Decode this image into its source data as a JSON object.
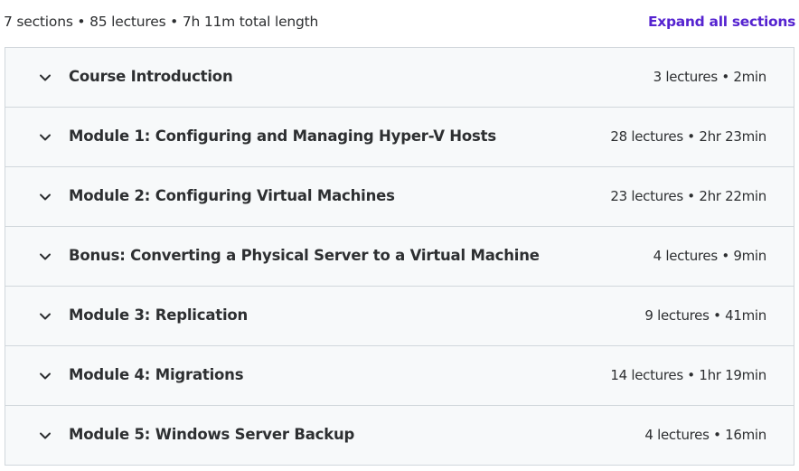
{
  "curriculum": {
    "summary": "7 sections • 85 lectures • 7h 11m total length",
    "expand_all_label": "Expand all sections",
    "accent_color": "#5624d0",
    "sections": [
      {
        "title": "Course Introduction",
        "meta": "3 lectures • 2min",
        "icon": "chevron-down-icon"
      },
      {
        "title": "Module 1: Configuring and Managing Hyper-V Hosts",
        "meta": "28 lectures • 2hr 23min",
        "icon": "chevron-down-icon"
      },
      {
        "title": "Module 2: Configuring Virtual Machines",
        "meta": "23 lectures • 2hr 22min",
        "icon": "chevron-down-icon"
      },
      {
        "title": "Bonus: Converting a Physical Server to a Virtual Machine",
        "meta": "4 lectures • 9min",
        "icon": "chevron-down-icon"
      },
      {
        "title": "Module 3: Replication",
        "meta": "9 lectures • 41min",
        "icon": "chevron-down-icon"
      },
      {
        "title": "Module 4: Migrations",
        "meta": "14 lectures • 1hr 19min",
        "icon": "chevron-down-icon"
      },
      {
        "title": "Module 5: Windows Server Backup",
        "meta": "4 lectures • 16min",
        "icon": "chevron-down-icon"
      }
    ]
  }
}
